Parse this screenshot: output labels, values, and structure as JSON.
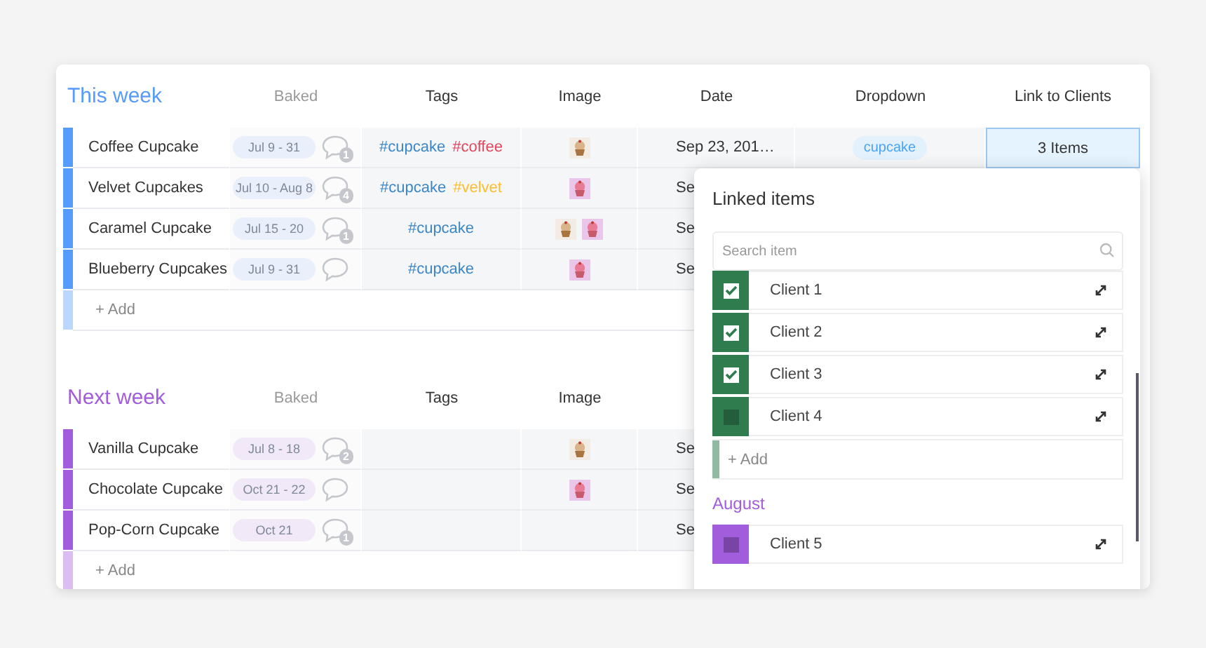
{
  "groups": [
    {
      "title": "This week",
      "color": "#579bfc",
      "columns": [
        "Baked",
        "Tags",
        "Image",
        "Date",
        "Dropdown",
        "Link to Clients"
      ],
      "rows": [
        {
          "name": "Coffee Cupcake",
          "baked": "Jul 9 - 31",
          "comments": "1",
          "tags": [
            {
              "text": "#cupcake",
              "color": "#3b86c6"
            },
            {
              "text": "#coffee",
              "color": "#e2445c"
            }
          ],
          "images": [
            {
              "kind": "picture"
            }
          ],
          "date": "Sep 23, 201…",
          "dropdown": "cupcake",
          "link": {
            "text": "3 Items",
            "selected": true
          }
        },
        {
          "name": "Velvet Cupcakes",
          "baked": "Jul 10 - Aug 8",
          "comments": "4",
          "tags": [
            {
              "text": "#cupcake",
              "color": "#3b86c6"
            },
            {
              "text": "#velvet",
              "color": "#fdbc2f"
            }
          ],
          "images": [
            {
              "kind": "picture"
            }
          ],
          "date": "Se"
        },
        {
          "name": "Caramel Cupcake",
          "baked": "Jul 15 - 20",
          "comments": "1",
          "tags": [
            {
              "text": "#cupcake",
              "color": "#3b86c6"
            }
          ],
          "images": [
            {
              "kind": "picture"
            },
            {
              "kind": "picture"
            }
          ],
          "date": "Se"
        },
        {
          "name": "Blueberry Cupcakes",
          "baked": "Jul 9 - 31",
          "tags": [
            {
              "text": "#cupcake",
              "color": "#3b86c6"
            }
          ],
          "images": [
            {
              "kind": "picture"
            }
          ],
          "date": "Se"
        }
      ],
      "add": "+ Add"
    },
    {
      "title": "Next week",
      "color": "#a25ddc",
      "columns": [
        "Baked",
        "Tags",
        "Image"
      ],
      "rows": [
        {
          "name": "Vanilla Cupcake",
          "baked": "Jul 8 - 18",
          "comments": "2",
          "tags": [],
          "images": [
            {
              "kind": "picture"
            }
          ],
          "date": "Se"
        },
        {
          "name": "Chocolate Cupcake",
          "baked": "Oct 21 - 22",
          "tags": [],
          "images": [
            {
              "kind": "picture"
            }
          ],
          "date": "Se"
        },
        {
          "name": "Pop-Corn Cupcake",
          "baked": "Oct 21",
          "comments": "1",
          "tags": [],
          "images": [],
          "date": "Se"
        }
      ],
      "add": "+ Add"
    }
  ],
  "popup": {
    "title": "Linked items",
    "search": {
      "placeholder": "Search item"
    },
    "sections": [
      {
        "color": "#2f7d4f",
        "items": [
          {
            "name": "Client 1",
            "checked": true
          },
          {
            "name": "Client 2",
            "checked": true
          },
          {
            "name": "Client 3",
            "checked": true
          },
          {
            "name": "Client 4",
            "checked": false
          }
        ],
        "add": "+ Add"
      },
      {
        "title": "August",
        "color": "#a25ddc",
        "items": [
          {
            "name": "Client 5",
            "checked": false
          }
        ]
      }
    ]
  }
}
